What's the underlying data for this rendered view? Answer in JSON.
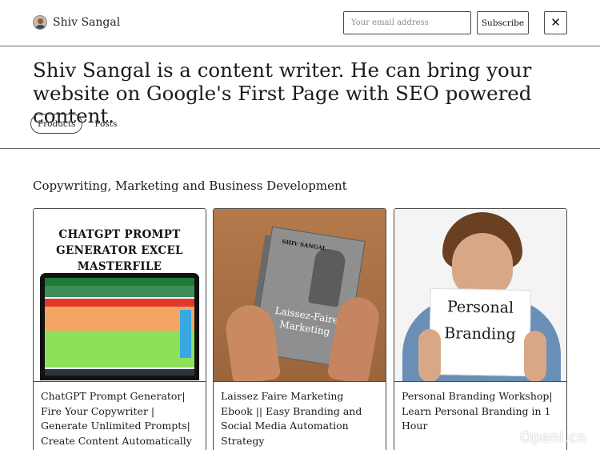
{
  "header": {
    "brand_name": "Shiv Sangal",
    "email_placeholder": "Your email address",
    "subscribe_label": "Subscribe",
    "close_label": "✕"
  },
  "hero": {
    "headline": "Shiv Sangal is a content writer. He can bring your website on Google's First Page with SEO powered content."
  },
  "tabs": [
    {
      "label": "Products",
      "active": true
    },
    {
      "label": "Posts",
      "active": false
    }
  ],
  "section": {
    "title": "Copywriting, Marketing and Business Development"
  },
  "products": [
    {
      "image_text": "CHATGPT PROMPT GENERATOR EXCEL MASTERFILE",
      "title": "ChatGPT Prompt Generator| Fire Your Copywriter | Generate Unlimited Prompts| Create Content Automatically"
    },
    {
      "image_author": "SHIV SANGAL",
      "image_text": "Laissez-Faire Marketing",
      "title": "Laissez Faire Marketing Ebook || Easy Branding and Social Media Automation Strategy"
    },
    {
      "image_text": "Personal Branding",
      "title": "Personal Branding Workshop| Learn Personal Branding in 1 Hour"
    }
  ],
  "watermark": "OpenI.cn"
}
